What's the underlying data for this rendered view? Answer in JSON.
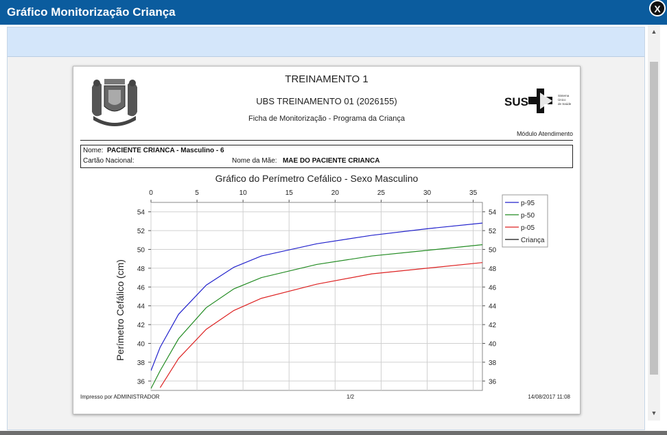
{
  "window": {
    "title": "Gráfico Monitorização Criança",
    "close_label": "X"
  },
  "scrollbar": {
    "up": "▲",
    "down": "▼"
  },
  "report": {
    "title": "TREINAMENTO 1",
    "unit": "UBS TREINAMENTO 01 (2026155)",
    "subtitle": "Ficha de Monitorização - Programa da Criança",
    "module": "Módulo Atendimento",
    "sus_logo_text": "SUS",
    "sus_tagline": [
      "Sistema",
      "Único",
      "de Saúde"
    ],
    "patient": {
      "name_label": "Nome:",
      "name_value": "PACIENTE CRIANCA - Masculino - 6",
      "card_label": "Cartão Nacional:",
      "mother_label": "Nome da Mãe:",
      "mother_value": "MAE DO PACIENTE CRIANCA"
    },
    "footer": {
      "printed_by": "Impresso por ADMINISTRADOR",
      "page": "1/2",
      "datetime": "14/08/2017 11:08"
    }
  },
  "chart_data": {
    "type": "line",
    "title": "Gráfico do Perímetro Cefálico - Sexo Masculino",
    "ylabel": "Perímetro Cefálico (cm)",
    "xlabel": "",
    "xlim": [
      0,
      36
    ],
    "ylim": [
      35,
      55
    ],
    "x_ticks": [
      0,
      5,
      10,
      15,
      20,
      25,
      30,
      35
    ],
    "y_ticks": [
      36,
      38,
      40,
      42,
      44,
      46,
      48,
      50,
      52,
      54
    ],
    "grid": true,
    "legend_position": "right",
    "series": [
      {
        "name": "p-95",
        "color": "#2222cc",
        "x": [
          0,
          1,
          3,
          6,
          9,
          12,
          18,
          24,
          30,
          36
        ],
        "y": [
          37.1,
          39.6,
          43.1,
          46.2,
          48.1,
          49.3,
          50.6,
          51.5,
          52.2,
          52.8
        ]
      },
      {
        "name": "p-50",
        "color": "#228b22",
        "x": [
          0,
          1,
          3,
          6,
          9,
          12,
          18,
          24,
          30,
          36
        ],
        "y": [
          35.2,
          37.1,
          40.5,
          43.8,
          45.8,
          47.0,
          48.4,
          49.3,
          49.9,
          50.5
        ]
      },
      {
        "name": "p-05",
        "color": "#dd2222",
        "x": [
          1,
          3,
          6,
          9,
          12,
          18,
          24,
          30,
          36
        ],
        "y": [
          35.3,
          38.4,
          41.5,
          43.5,
          44.8,
          46.3,
          47.4,
          48.0,
          48.6
        ]
      },
      {
        "name": "Criança",
        "color": "#111111",
        "x": [],
        "y": []
      }
    ]
  }
}
